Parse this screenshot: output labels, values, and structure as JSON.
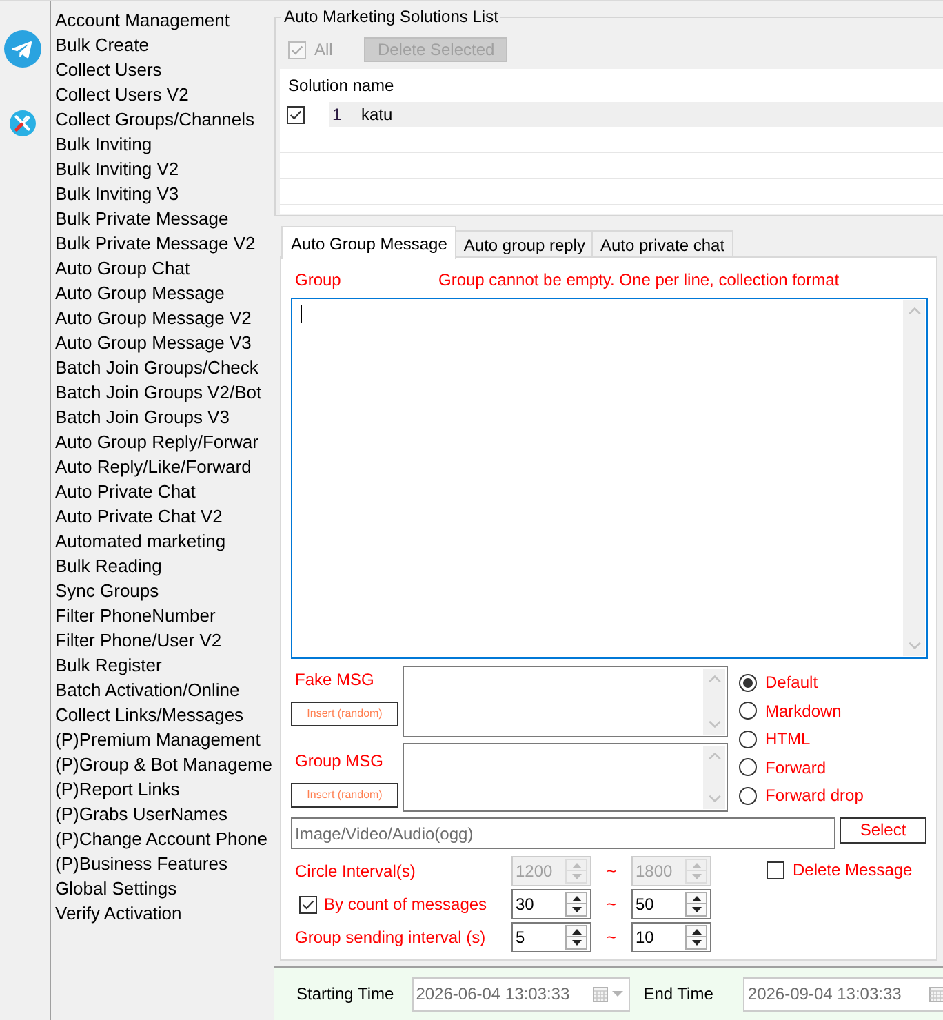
{
  "sidebar": {
    "items": [
      "Account Management",
      "Bulk Create",
      "Collect Users",
      "Collect Users V2",
      "Collect Groups/Channels",
      "Bulk Inviting",
      "Bulk Inviting V2",
      "Bulk Inviting V3",
      "Bulk Private Message",
      "Bulk Private Message V2",
      "Auto Group Chat",
      "Auto Group Message",
      "Auto Group Message V2",
      "Auto Group Message V3",
      "Batch Join Groups/Check",
      "Batch Join Groups V2/Bot",
      "Batch Join Groups V3",
      "Auto Group Reply/Forwar",
      "Auto Reply/Like/Forward",
      "Auto Private Chat",
      "Auto Private Chat V2",
      "Automated marketing",
      "Bulk Reading",
      "Sync Groups",
      "Filter PhoneNumber",
      "Filter Phone/User V2",
      "Bulk Register",
      "Batch Activation/Online",
      "Collect Links/Messages",
      "(P)Premium Management",
      "(P)Group & Bot Manageme",
      "(P)Report Links",
      "(P)Grabs UserNames",
      "(P)Change Account Phone",
      "(P)Business Features",
      "Global Settings",
      "Verify Activation"
    ]
  },
  "solutions_list": {
    "title": "Auto Marketing Solutions List",
    "select_all": {
      "label": "All",
      "checked": true,
      "disabled": true
    },
    "delete_button": {
      "label": "Delete Selected",
      "disabled": true
    },
    "columns": [
      "Solution name"
    ],
    "rows": [
      {
        "checked": true,
        "index": "1",
        "name": "katu"
      }
    ]
  },
  "tabs": [
    {
      "label": "Auto Group Message",
      "selected": true
    },
    {
      "label": "Auto group reply",
      "selected": false
    },
    {
      "label": "Auto private chat",
      "selected": false
    }
  ],
  "group": {
    "label": "Group",
    "hint": "Group cannot be empty. One per line, collection format",
    "focused": true
  },
  "messages": [
    {
      "label": "Fake MSG",
      "insert_button": "Insert (random)"
    },
    {
      "label": "Group MSG",
      "insert_button": "Insert (random)"
    }
  ],
  "format_options": [
    {
      "label": "Default",
      "selected": true
    },
    {
      "label": "Markdown",
      "selected": false
    },
    {
      "label": "HTML",
      "selected": false
    },
    {
      "label": "Forward",
      "selected": false
    },
    {
      "label": "Forward drop",
      "selected": false
    }
  ],
  "media": {
    "placeholder": "Image/Video/Audio(ogg)",
    "button": "Select"
  },
  "intervals": [
    {
      "kind": "label",
      "label": "Circle Interval(s)",
      "from": "1200",
      "separator": "~",
      "to": "1800",
      "disabled": true
    },
    {
      "kind": "checkbox",
      "label": "By count of messages",
      "checked": true,
      "from": "30",
      "separator": "~",
      "to": "50",
      "disabled": false
    },
    {
      "kind": "label",
      "label": "Group sending interval (s)",
      "from": "5",
      "separator": "~",
      "to": "10",
      "disabled": false
    }
  ],
  "delete_message": {
    "label": "Delete Message",
    "checked": false
  },
  "schedule": [
    {
      "label": "Starting Time",
      "value": "2026-06-04 13:03:33",
      "disabled": true
    },
    {
      "label": "End Time",
      "value": "2026-09-04 13:03:33",
      "disabled": true
    }
  ]
}
